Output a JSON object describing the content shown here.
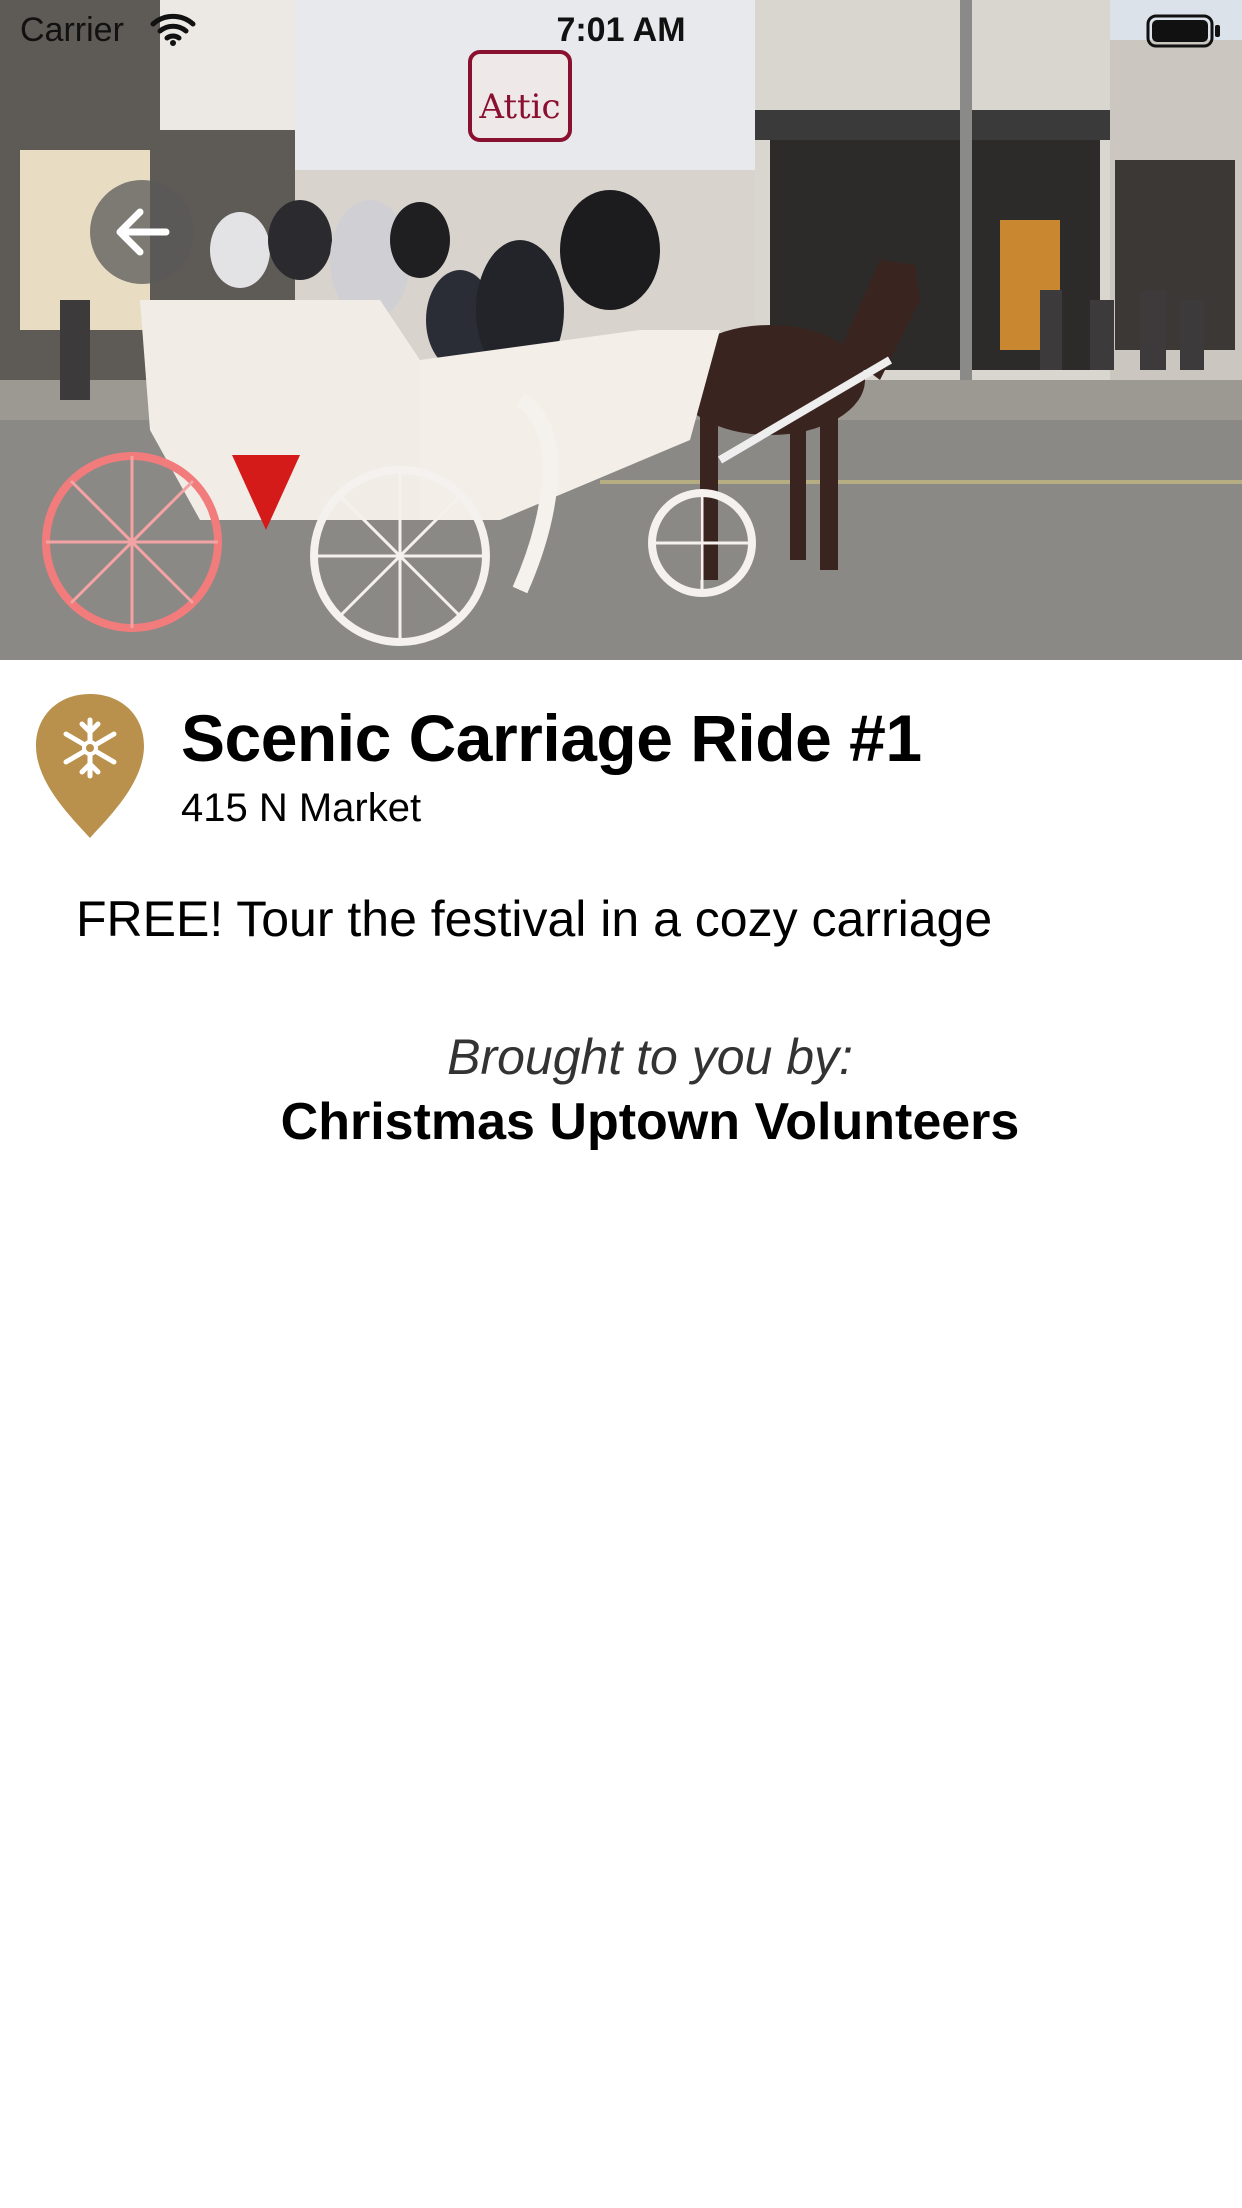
{
  "status_bar": {
    "carrier": "Carrier",
    "time": "7:01 AM"
  },
  "hero": {
    "icon": "photo-horse-carriage",
    "sign_text": "Attic"
  },
  "back_icon": "arrow-left-icon",
  "event": {
    "title": "Scenic Carriage Ride #1",
    "address": "415 N Market",
    "description": "FREE! Tour the festival in a cozy carriage",
    "pin_icon": "snowflake-pin-icon",
    "pin_color": "#b9914c"
  },
  "sponsor": {
    "intro": "Brought to you by:",
    "name": "Christmas Uptown Volunteers"
  }
}
